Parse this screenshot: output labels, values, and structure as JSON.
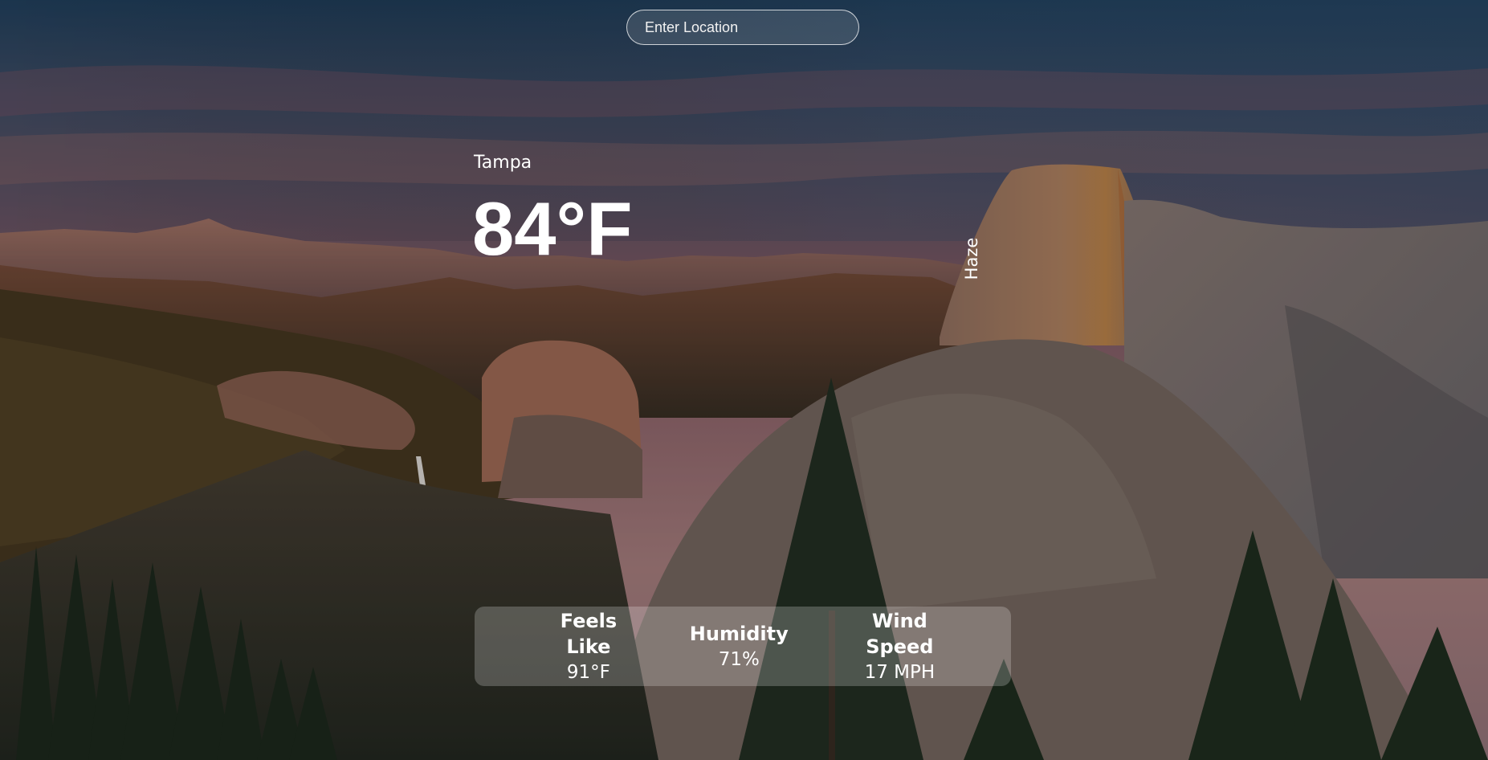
{
  "search": {
    "placeholder": "Enter Location",
    "value": ""
  },
  "weather": {
    "location": "Tampa",
    "temperature": "84°F",
    "condition": "Haze"
  },
  "stats": {
    "feels_like": {
      "label": "Feels Like",
      "value": "91°F"
    },
    "humidity": {
      "label": "Humidity",
      "value": "71%"
    },
    "wind_speed": {
      "label": "Wind Speed",
      "value": "17 MPH"
    }
  },
  "colors": {
    "sky_top": "#2f4a6a",
    "sky_mid": "#7a5a6a",
    "sky_glow": "#b07a78",
    "rock": "#8a6a58",
    "forest": "#223322",
    "text": "#ffffff"
  },
  "background": {
    "description_icon": "mountain-landscape-image"
  }
}
